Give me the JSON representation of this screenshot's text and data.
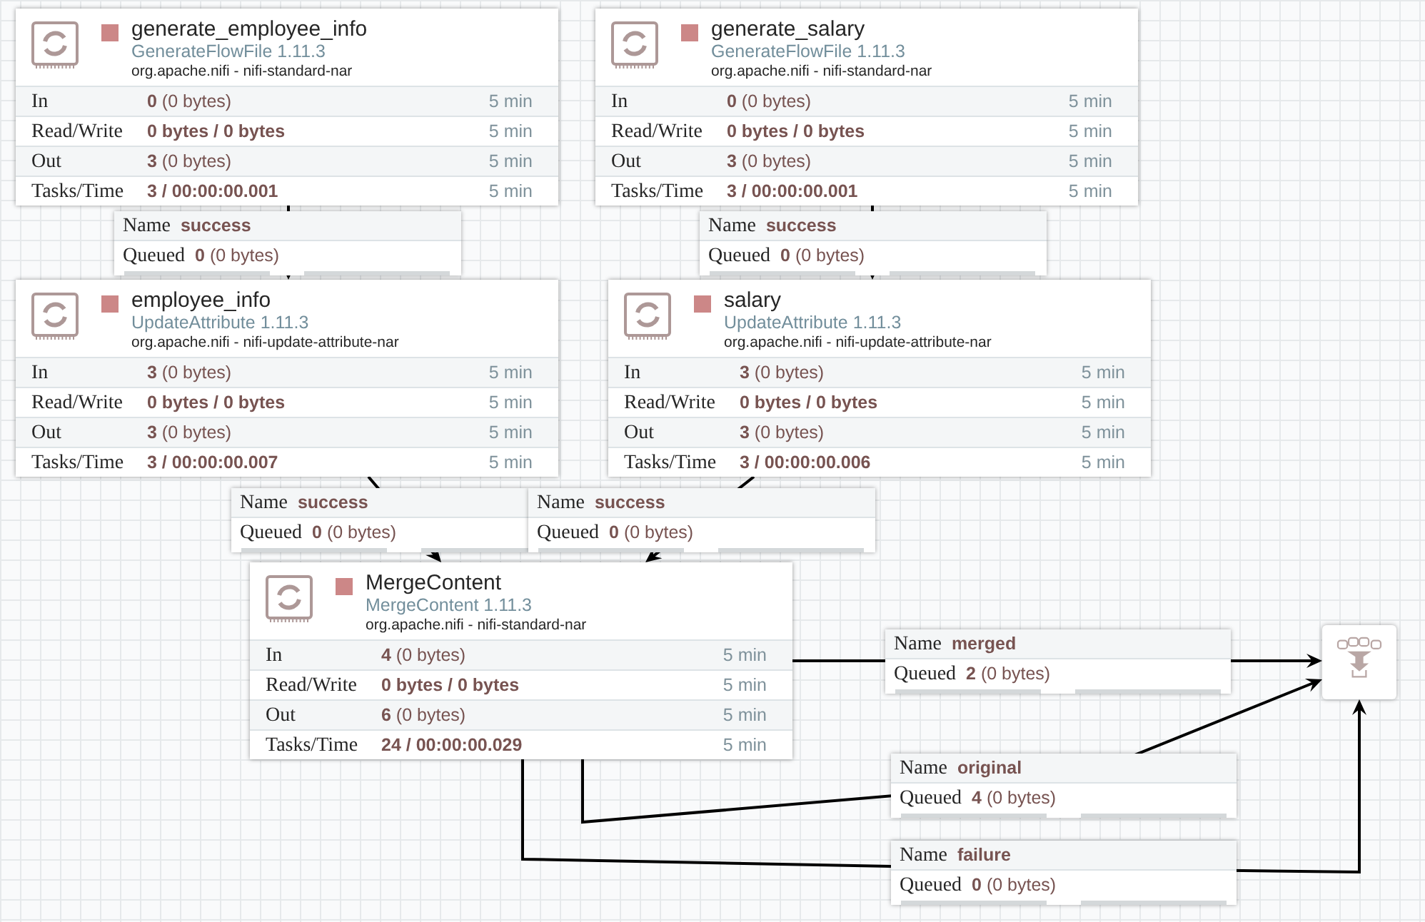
{
  "processors": [
    {
      "name": "generate_employee_info",
      "type": "GenerateFlowFile 1.11.3",
      "bundle": "org.apache.nifi - nifi-standard-nar",
      "stopped": true,
      "stats": [
        {
          "label": "In",
          "value": "0",
          "detail": "(0 bytes)",
          "window": "5 min"
        },
        {
          "label": "Read/Write",
          "value": "0 bytes / 0 bytes",
          "window": "5 min"
        },
        {
          "label": "Out",
          "value": "3",
          "detail": "(0 bytes)",
          "window": "5 min"
        },
        {
          "label": "Tasks/Time",
          "value": "3 / 00:00:00.001",
          "window": "5 min"
        }
      ]
    },
    {
      "name": "generate_salary",
      "type": "GenerateFlowFile 1.11.3",
      "bundle": "org.apache.nifi - nifi-standard-nar",
      "stopped": true,
      "stats": [
        {
          "label": "In",
          "value": "0",
          "detail": "(0 bytes)",
          "window": "5 min"
        },
        {
          "label": "Read/Write",
          "value": "0 bytes / 0 bytes",
          "window": "5 min"
        },
        {
          "label": "Out",
          "value": "3",
          "detail": "(0 bytes)",
          "window": "5 min"
        },
        {
          "label": "Tasks/Time",
          "value": "3 / 00:00:00.001",
          "window": "5 min"
        }
      ]
    },
    {
      "name": "employee_info",
      "type": "UpdateAttribute 1.11.3",
      "bundle": "org.apache.nifi - nifi-update-attribute-nar",
      "stopped": true,
      "stats": [
        {
          "label": "In",
          "value": "3",
          "detail": "(0 bytes)",
          "window": "5 min"
        },
        {
          "label": "Read/Write",
          "value": "0 bytes / 0 bytes",
          "window": "5 min"
        },
        {
          "label": "Out",
          "value": "3",
          "detail": "(0 bytes)",
          "window": "5 min"
        },
        {
          "label": "Tasks/Time",
          "value": "3 / 00:00:00.007",
          "window": "5 min"
        }
      ]
    },
    {
      "name": "salary",
      "type": "UpdateAttribute 1.11.3",
      "bundle": "org.apache.nifi - nifi-update-attribute-nar",
      "stopped": true,
      "stats": [
        {
          "label": "In",
          "value": "3",
          "detail": "(0 bytes)",
          "window": "5 min"
        },
        {
          "label": "Read/Write",
          "value": "0 bytes / 0 bytes",
          "window": "5 min"
        },
        {
          "label": "Out",
          "value": "3",
          "detail": "(0 bytes)",
          "window": "5 min"
        },
        {
          "label": "Tasks/Time",
          "value": "3 / 00:00:00.006",
          "window": "5 min"
        }
      ]
    },
    {
      "name": "MergeContent",
      "type": "MergeContent 1.11.3",
      "bundle": "org.apache.nifi - nifi-standard-nar",
      "stopped": true,
      "stats": [
        {
          "label": "In",
          "value": "4",
          "detail": "(0 bytes)",
          "window": "5 min"
        },
        {
          "label": "Read/Write",
          "value": "0 bytes / 0 bytes",
          "window": "5 min"
        },
        {
          "label": "Out",
          "value": "6",
          "detail": "(0 bytes)",
          "window": "5 min"
        },
        {
          "label": "Tasks/Time",
          "value": "24 / 00:00:00.029",
          "window": "5 min"
        }
      ]
    }
  ],
  "connections": [
    {
      "name_label": "Name",
      "name": "success",
      "queued_label": "Queued",
      "count": "0",
      "size": "(0 bytes)",
      "backpressure": [
        {
          "level": 0
        },
        {
          "level": 0
        }
      ]
    },
    {
      "name_label": "Name",
      "name": "success",
      "queued_label": "Queued",
      "count": "0",
      "size": "(0 bytes)",
      "backpressure": [
        {
          "level": 0
        },
        {
          "level": 0
        }
      ]
    },
    {
      "name_label": "Name",
      "name": "success",
      "queued_label": "Queued",
      "count": "0",
      "size": "(0 bytes)",
      "backpressure": [
        {
          "level": 0
        },
        {
          "level": 0
        }
      ]
    },
    {
      "name_label": "Name",
      "name": "success",
      "queued_label": "Queued",
      "count": "0",
      "size": "(0 bytes)",
      "backpressure": [
        {
          "level": 0
        },
        {
          "level": 0
        }
      ]
    },
    {
      "name_label": "Name",
      "name": "merged",
      "queued_label": "Queued",
      "count": "2",
      "size": "(0 bytes)",
      "backpressure": [
        {
          "level": 0
        },
        {
          "level": 0
        }
      ]
    },
    {
      "name_label": "Name",
      "name": "original",
      "queued_label": "Queued",
      "count": "4",
      "size": "(0 bytes)",
      "backpressure": [
        {
          "level": 0
        },
        {
          "level": 0
        }
      ]
    },
    {
      "name_label": "Name",
      "name": "failure",
      "queued_label": "Queued",
      "count": "0",
      "size": "(0 bytes)",
      "backpressure": [
        {
          "level": 0
        },
        {
          "level": 0
        }
      ]
    }
  ]
}
